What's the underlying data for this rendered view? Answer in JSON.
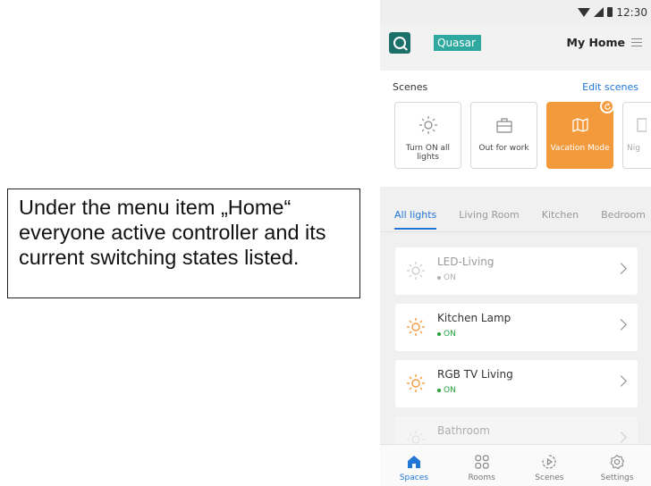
{
  "caption": {
    "text": "Under the menu item „Home“ everyone active controller and its current switching states listed."
  },
  "status_bar": {
    "time": "12:30"
  },
  "app_bar": {
    "brand": "Quasar",
    "home_title": "My Home",
    "icons": {
      "logo": "quasar-logo-icon",
      "menu": "hamburger-menu-icon"
    }
  },
  "scenes": {
    "title": "Scenes",
    "edit_label": "Edit scenes",
    "items": [
      {
        "label": "Turn ON all lights",
        "icon": "sun-icon",
        "active": false
      },
      {
        "label": "Out for work",
        "icon": "briefcase-icon",
        "active": false
      },
      {
        "label": "Vacation Mode",
        "icon": "map-icon",
        "active": true
      },
      {
        "label": "Nig",
        "icon": "moon-icon",
        "active": false
      }
    ]
  },
  "tabs": [
    {
      "label": "All lights",
      "active": true
    },
    {
      "label": "Living Room",
      "active": false
    },
    {
      "label": "Kitchen",
      "active": false
    },
    {
      "label": "Bedroom",
      "active": false
    }
  ],
  "devices": [
    {
      "name": "LED-Living",
      "state": "ON",
      "lit": false
    },
    {
      "name": "Kitchen Lamp",
      "state": "ON",
      "lit": true
    },
    {
      "name": "RGB TV Living",
      "state": "ON",
      "lit": true
    },
    {
      "name": "Bathroom",
      "state": "",
      "lit": false
    }
  ],
  "bottom_nav": [
    {
      "label": "Spaces",
      "icon": "home-icon",
      "active": true
    },
    {
      "label": "Rooms",
      "icon": "grid-icon",
      "active": false
    },
    {
      "label": "Scenes",
      "icon": "play-circle-icon",
      "active": false
    },
    {
      "label": "Settings",
      "icon": "gear-icon",
      "active": false
    }
  ],
  "colors": {
    "accent_blue": "#2176d6",
    "scene_active": "#f39a3d",
    "status_on": "#21a33a",
    "brand_teal": "#2fa9a0"
  }
}
